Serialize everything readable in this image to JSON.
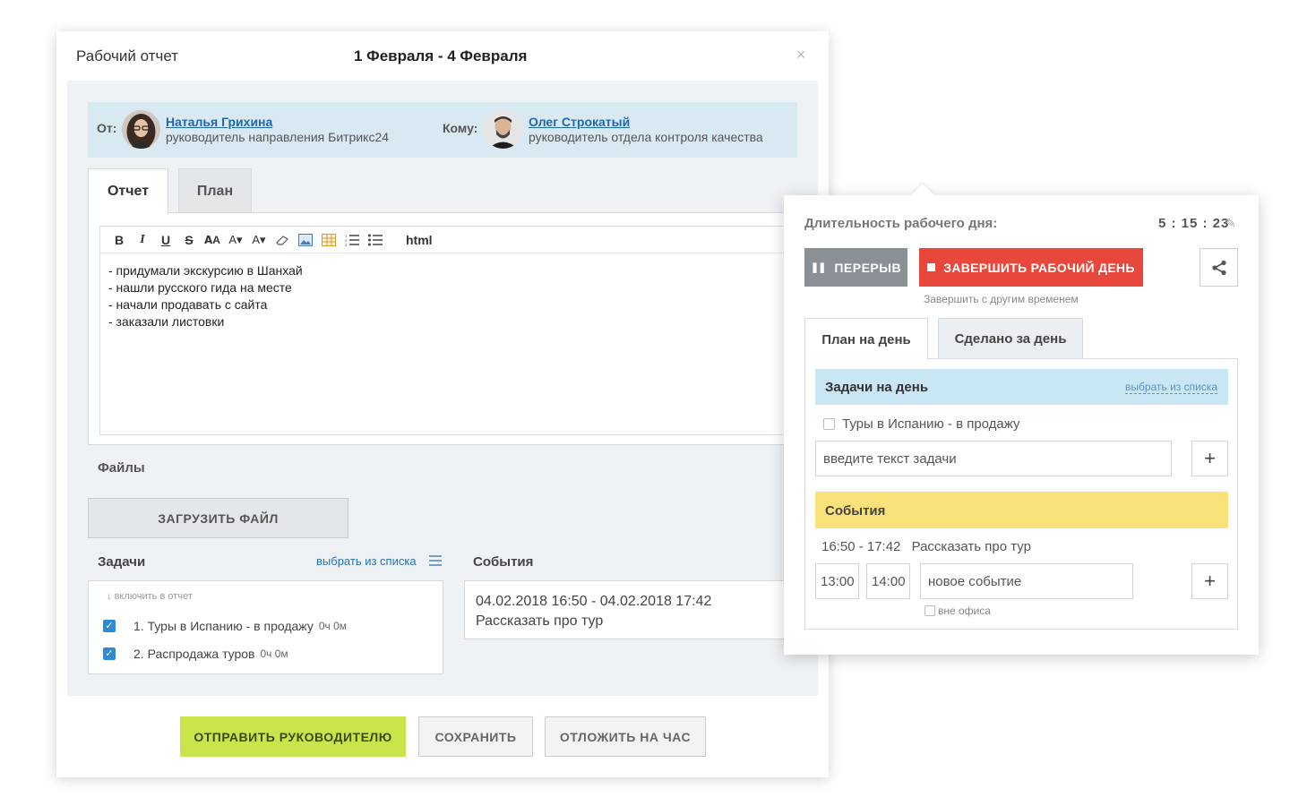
{
  "report": {
    "title": "Рабочий отчет",
    "dates": "1 Февраля - 4 Февраля",
    "close": "×",
    "from_label": "От:",
    "to_label": "Кому:",
    "from": {
      "name": "Наталья Грихина",
      "role": "руководитель направления Битрикс24"
    },
    "to": {
      "name": "Олег Строкатый",
      "role": "руководитель отдела контроля качества"
    },
    "tabs": [
      {
        "label": "Отчет"
      },
      {
        "label": "План"
      }
    ],
    "toolbar_html": "html",
    "editor_lines": [
      "- придумали экскурсию в Шанхай",
      "- нашли русского гида на месте",
      "- начали продавать с сайта",
      "- заказали листовки"
    ],
    "files_label": "Файлы",
    "upload_button": "ЗАГРУЗИТЬ ФАЙЛ",
    "tasks_label": "Задачи",
    "pick_from_list": "выбрать из списка",
    "include_note": "включить в отчет",
    "tasks": [
      {
        "text": "1. Туры в Испанию - в продажу",
        "time": "0ч 0м",
        "checked": true
      },
      {
        "text": "2. Распродажа туров",
        "time": "0ч 0м",
        "checked": true
      }
    ],
    "events_label": "События",
    "event": {
      "range": "04.02.2018 16:50 - 04.02.2018 17:42",
      "title": "Рассказать про тур"
    },
    "buttons": {
      "send": "ОТПРАВИТЬ РУКОВОДИТЕЛЮ",
      "save": "СОХРАНИТЬ",
      "postpone": "ОТЛОЖИТЬ НА ЧАС"
    }
  },
  "workday": {
    "duration_label": "Длительность рабочего дня:",
    "timer": "5 : 15 : 23",
    "pause_button": "ПЕРЕРЫВ",
    "finish_button": "ЗАВЕРШИТЬ РАБОЧИЙ ДЕНЬ",
    "finish_other_time": "Завершить с другим временем",
    "tabs": [
      {
        "label": "План на день"
      },
      {
        "label": "Сделано за день"
      }
    ],
    "tasks_header": "Задачи на день",
    "pick_from_list": "выбрать из списка",
    "task": "Туры в Испанию - в продажу",
    "task_placeholder": "введите текст задачи",
    "events_header": "События",
    "event_time": "16:50 - 17:42",
    "event_title": "Рассказать про тур",
    "new_event_from": "13:00",
    "new_event_to": "14:00",
    "new_event_placeholder": "новое событие",
    "offsite_label": "вне офиса"
  },
  "colors": {
    "send_button": "#c9e54b",
    "finish_button": "#e8473b",
    "pause_button": "#8a9095",
    "tasks_header": "#c9e6f5",
    "events_header": "#f9e27a",
    "link": "#1f67b0"
  }
}
